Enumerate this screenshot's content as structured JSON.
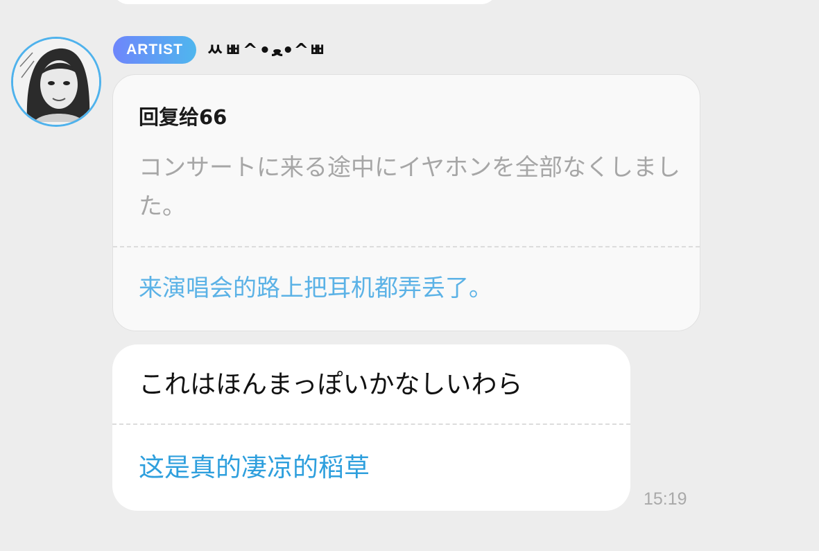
{
  "message": {
    "sender_badge": "ARTIST",
    "sender_name": "ㅆㅃ^•ﻌ•^ㅃ",
    "avatar_icon": "artist-avatar",
    "reply": {
      "title": "回复给66",
      "original_text": "コンサートに来る途中にイヤホンを全部なくしました。",
      "translation": "来演唱会的路上把耳机都弄丢了。"
    },
    "body": {
      "text": "これはほんまっぽいかなしいわら",
      "translation": "这是真的凄凉的稻草"
    },
    "timestamp": "15:19"
  },
  "colors": {
    "background": "#ededed",
    "badge_gradient_start": "#6e86fb",
    "badge_gradient_end": "#4fb6ee",
    "avatar_ring": "#4fb2ec",
    "translation_text": "#2e9fdd",
    "muted_text": "#a6a6a6"
  }
}
